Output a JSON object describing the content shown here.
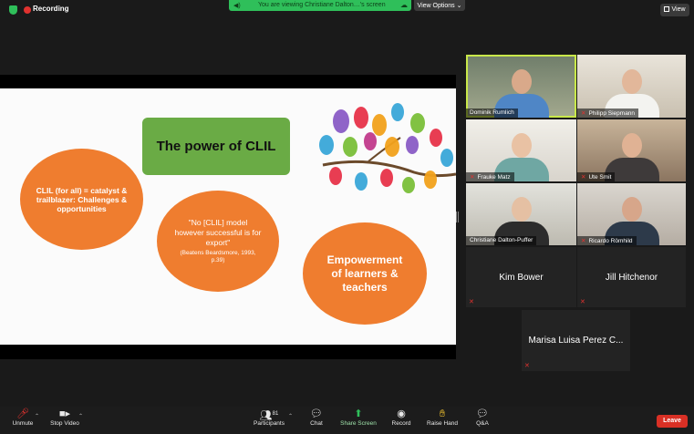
{
  "top_bar": {
    "recording_label": "Recording",
    "share_banner_text": "You are viewing Christiane Dalton…'s screen",
    "view_options_label": "View Options ⌄",
    "view_label": "View"
  },
  "slide": {
    "title_box": "The power of CLIL",
    "oval_left": "CLIL (for all) = catalyst & trailblazer: Challenges & opportunities",
    "oval_middle_quote": "\"No [CLIL] model however successful is for export\"",
    "oval_middle_citation": "(Beatens Beardsmore, 1993, p.39)",
    "oval_right": "Empowerment of learners & teachers"
  },
  "participants": [
    {
      "name": "Dominik Rumlich",
      "muted": false,
      "active_speaker": true
    },
    {
      "name": "Philipp Siepmann",
      "muted": true
    },
    {
      "name": "Frauke Matz",
      "muted": true
    },
    {
      "name": "Ute Smit",
      "muted": true
    },
    {
      "name": "Christiane Dalton-Puffer",
      "muted": false
    },
    {
      "name": "Ricardo Römhild",
      "muted": true
    },
    {
      "name": "Kim Bower",
      "muted": true,
      "video_off": true
    },
    {
      "name": "Jill Hitchenor",
      "muted": true,
      "video_off": true
    },
    {
      "name": "Marisa Luisa Perez C...",
      "muted": true,
      "video_off": true
    }
  ],
  "toolbar": {
    "unmute": "Unmute",
    "stop_video": "Stop Video",
    "participants": "Participants",
    "participant_count": "81",
    "chat": "Chat",
    "share_screen": "Share Screen",
    "record": "Record",
    "raise_hand": "Raise Hand",
    "qa": "Q&A",
    "leave": "Leave"
  },
  "colors": {
    "accent_green": "#2fbf5a",
    "slide_orange": "#ef7d2f",
    "slide_green": "#6aab45",
    "leave_red": "#d93025",
    "active_speaker_outline": "#c9e84a"
  }
}
